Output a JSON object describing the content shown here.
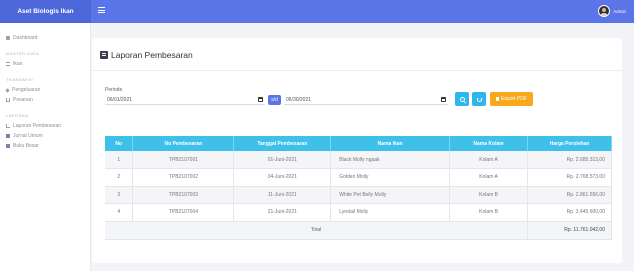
{
  "brand": "Aset Biologis Ikan",
  "user": {
    "name": "Admin"
  },
  "sidebar": {
    "dashboard": "Dashboard",
    "section_master": "MASTER DATA",
    "ikan": "Ikan",
    "section_transaksi": "TRANSAKSI",
    "pengeluaran": "Pengeluaran",
    "pesanan": "Pesanan",
    "section_laporan": "LAPORAN",
    "laporan_pembesaran": "Laporan Pembesaran",
    "jurnal_umum": "Jurnal Umum",
    "buku_besar": "Buku Besar"
  },
  "page": {
    "title": "Laporan Pembesaran"
  },
  "filter": {
    "periode_label": "Periode",
    "start_date": "06/01/2021",
    "separator": "s/d",
    "end_date": "06/30/2021",
    "export_label": "Export PDF"
  },
  "table": {
    "headers": [
      "No",
      "No Pembesaran",
      "Tanggal Pembesaran",
      "Nama Ikan",
      "Nama Kolam",
      "Harga Perolehan"
    ],
    "rows": [
      [
        "1",
        "TPB2107001",
        "01-Juni-2021",
        "Black Molly ngaak",
        "Kolam A",
        "Rp. 2.685.313,00"
      ],
      [
        "2",
        "TPB2107002",
        "04-Juni-2021",
        "Golden Molly",
        "Kolam A",
        "Rp. 2.768.573,00"
      ],
      [
        "3",
        "TPB2107003",
        "11-Juni-2021",
        "White Pet Belly Molly",
        "Kolam B",
        "Rp. 2.861.556,00"
      ],
      [
        "4",
        "TPB2107004",
        "21-Juni-2021",
        "Lyretail Molly",
        "Kolam B",
        "Rp. 3.445.600,00"
      ]
    ],
    "total_label": "Total",
    "total_value": "Rp. 11.761.042,00"
  },
  "colors": {
    "primary": "#5b75e8",
    "brand_bg": "#4d67db",
    "table_header": "#3fc0ea",
    "button_info": "#2fb6ea",
    "button_pdf": "#f7a81b"
  }
}
